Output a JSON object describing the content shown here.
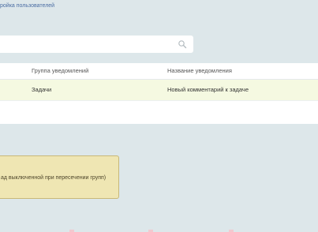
{
  "breadcrumb": {
    "text": "ройка пользователей"
  },
  "search": {
    "value": "",
    "placeholder": "",
    "icon": "search-icon"
  },
  "table": {
    "headers": {
      "group": "Группа уведомлений",
      "name": "Название уведомления"
    },
    "rows": [
      {
        "group": "Задачи",
        "name": "Новый комментарий к задаче"
      }
    ]
  },
  "notice": {
    "text": "ад выключенной при пересечении групп)"
  },
  "colors": {
    "background": "#dde7ea",
    "highlight_row": "#f5f9e1",
    "notice": "#efe6b3"
  }
}
